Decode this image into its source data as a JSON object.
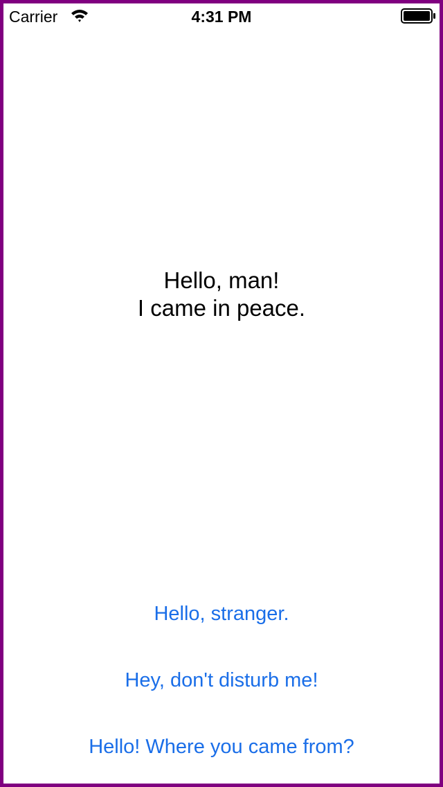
{
  "status_bar": {
    "carrier": "Carrier",
    "time": "4:31 PM",
    "icons": [
      "wifi-icon",
      "battery-icon"
    ]
  },
  "message": {
    "line1": "Hello, man!",
    "line2": "I came in peace."
  },
  "replies": [
    {
      "label": "Hello, stranger."
    },
    {
      "label": "Hey, don't disturb me!"
    },
    {
      "label": "Hello! Where you came from?"
    }
  ],
  "colors": {
    "frame_border": "#800080",
    "button_text": "#1a6ee8",
    "text": "#000000",
    "background": "#ffffff"
  }
}
